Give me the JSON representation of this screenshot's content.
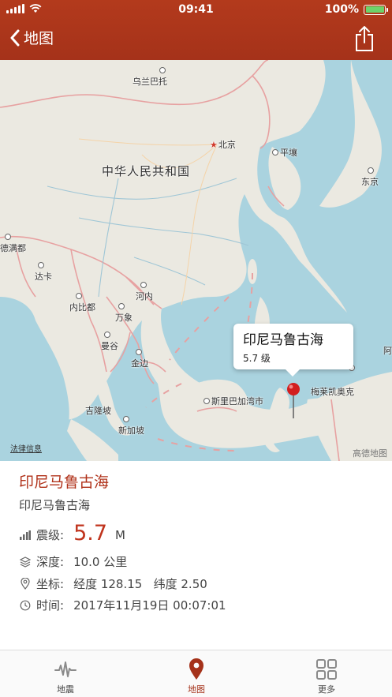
{
  "status_bar": {
    "time": "09:41",
    "battery_percent": "100%",
    "battery_level": 1.0
  },
  "nav": {
    "back_label": "地图"
  },
  "map": {
    "labels": {
      "ulaanbaatar": "乌兰巴托",
      "beijing": "北京",
      "pyongyang": "平壤",
      "tokyo": "东京",
      "china": "中华人民共和国",
      "dhaka_prefix": "德满都",
      "dhaka": "达卡",
      "hanoi": "河内",
      "naypyidaw": "内比都",
      "vientiane": "万象",
      "bangkok": "曼谷",
      "phnompenh": "金边",
      "kualalumpur": "吉隆坡",
      "singapore": "新加坡",
      "bandar": "斯里巴加湾市",
      "manokwari": "梅莱凯奥克",
      "edge_a": "阿"
    },
    "callout_title": "印尼马鲁古海",
    "callout_magnitude": "5.7 级",
    "legal_link": "法律信息",
    "provider_logo": "高德地图",
    "colors": {
      "land": "#ebe9e1",
      "water": "#aad3df",
      "border": "#e7a1a1"
    }
  },
  "details": {
    "title": "印尼马鲁古海",
    "subtitle": "印尼马鲁古海",
    "magnitude_label": "震级:",
    "magnitude_value": "5.7",
    "magnitude_unit": "M",
    "depth_label": "深度:",
    "depth_value": "10.0 公里",
    "coord_label": "坐标:",
    "coord_value": "经度 128.15   纬度 2.50",
    "time_label": "时间:",
    "time_value": "2017年11月19日 00:07:01"
  },
  "tabbar": {
    "tabs": [
      {
        "label": "地震",
        "icon": "waveform-icon",
        "active": false
      },
      {
        "label": "地图",
        "icon": "map-pin-icon",
        "active": true
      },
      {
        "label": "更多",
        "icon": "grid-icon",
        "active": false
      }
    ]
  },
  "accent_color": "#a5321a"
}
